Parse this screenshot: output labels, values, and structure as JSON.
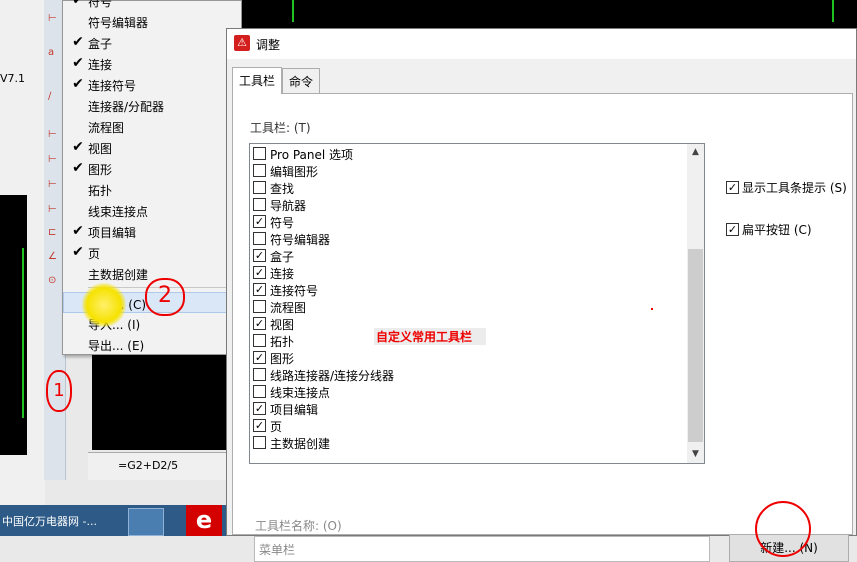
{
  "background": {
    "version_text": "V7.1",
    "sheet_tab_label": "=G2+D2/5",
    "taskbar_text": "中国亿万电器网 -...",
    "taskbar_app_letter": "e"
  },
  "context_menu": {
    "items": [
      {
        "label": "符号",
        "checked": true
      },
      {
        "label": "符号编辑器",
        "checked": false
      },
      {
        "label": "盒子",
        "checked": true
      },
      {
        "label": "连接",
        "checked": true
      },
      {
        "label": "连接符号",
        "checked": true
      },
      {
        "label": "连接器/分配器",
        "checked": false
      },
      {
        "label": "流程图",
        "checked": false
      },
      {
        "label": "视图",
        "checked": true
      },
      {
        "label": "图形",
        "checked": true
      },
      {
        "label": "拓扑",
        "checked": false
      },
      {
        "label": "线束连接点",
        "checked": false
      },
      {
        "label": "项目编辑",
        "checked": true
      },
      {
        "label": "页",
        "checked": true
      },
      {
        "label": "主数据创建",
        "checked": false
      }
    ],
    "actions": [
      {
        "label": "调整... (C)"
      },
      {
        "label": "导入... (I)"
      },
      {
        "label": "导出... (E)"
      }
    ],
    "check_glyph": "✔"
  },
  "annotations": {
    "one": "1",
    "two": "2"
  },
  "dialog": {
    "title": "调整",
    "tabs": [
      "工具栏",
      "命令"
    ],
    "toolbars_label": "工具栏: (T)",
    "toolbar_list": [
      {
        "label": "Pro Panel 选项",
        "checked": false
      },
      {
        "label": "编辑图形",
        "checked": false
      },
      {
        "label": "查找",
        "checked": false
      },
      {
        "label": "导航器",
        "checked": false
      },
      {
        "label": "符号",
        "checked": true
      },
      {
        "label": "符号编辑器",
        "checked": false
      },
      {
        "label": "盒子",
        "checked": true
      },
      {
        "label": "连接",
        "checked": true
      },
      {
        "label": "连接符号",
        "checked": true
      },
      {
        "label": "流程图",
        "checked": false
      },
      {
        "label": "视图",
        "checked": true
      },
      {
        "label": "拓扑",
        "checked": false
      },
      {
        "label": "图形",
        "checked": true
      },
      {
        "label": "线路连接器/连接分线器",
        "checked": false
      },
      {
        "label": "线束连接点",
        "checked": false
      },
      {
        "label": "项目编辑",
        "checked": true
      },
      {
        "label": "页",
        "checked": true
      },
      {
        "label": "主数据创建",
        "checked": false
      }
    ],
    "overlay_note": "自定义常用工具栏",
    "show_tooltips": {
      "label": "显示工具条提示 (S)",
      "checked": true
    },
    "flat_buttons": {
      "label": "扁平按钮 (C)",
      "checked": true
    },
    "toolbar_name_label": "工具栏名称: (O)",
    "toolbar_name_value": "菜单栏",
    "new_button_label": "新建... (N)",
    "checkbox_glyph": "✓"
  }
}
